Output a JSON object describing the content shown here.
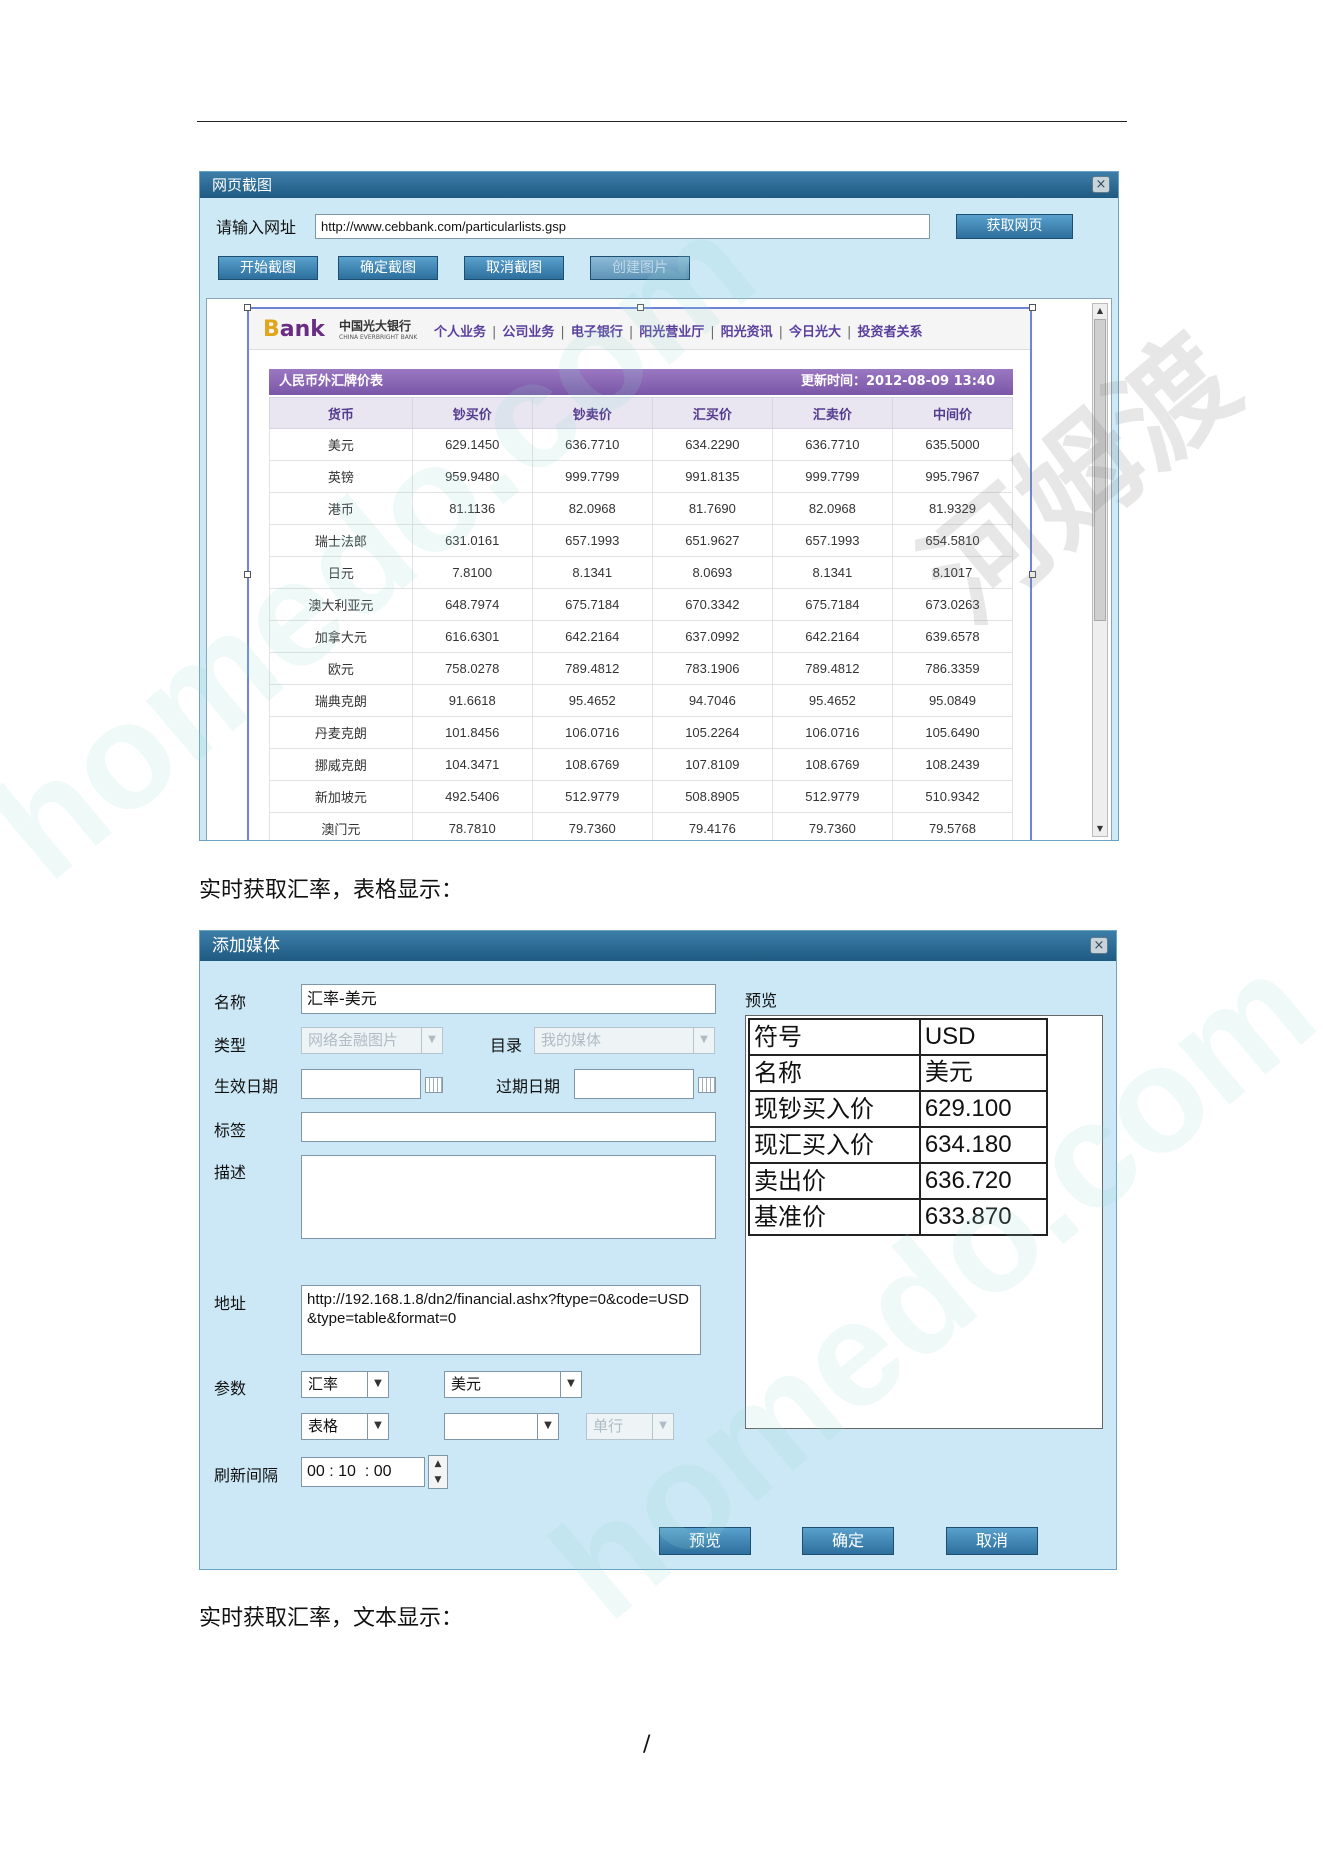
{
  "screenshot1": {
    "title": "网页截图",
    "close": "×",
    "url_label": "请输入网址",
    "url_value": "http://www.cebbank.com/particularlists.gsp",
    "fetch_button": "获取网页",
    "buttons": [
      "开始截图",
      "确定截图",
      "取消截图",
      "创建图片"
    ],
    "bank": {
      "logo_first": "B",
      "logo_rest": "ank",
      "name": "中国光大银行",
      "name_en": "CHINA EVERBRIGHT BANK",
      "nav": [
        "个人业务",
        "公司业务",
        "电子银行",
        "阳光营业厅",
        "阳光资讯",
        "今日光大",
        "投资者关系"
      ],
      "separator": "|"
    },
    "table_title": "人民币外汇牌价表",
    "updated": "更新时间：2012-08-09 13:40",
    "columns": [
      "货币",
      "钞买价",
      "钞卖价",
      "汇买价",
      "汇卖价",
      "中间价"
    ],
    "rows": [
      [
        "美元",
        "629.1450",
        "636.7710",
        "634.2290",
        "636.7710",
        "635.5000"
      ],
      [
        "英镑",
        "959.9480",
        "999.7799",
        "991.8135",
        "999.7799",
        "995.7967"
      ],
      [
        "港币",
        "81.1136",
        "82.0968",
        "81.7690",
        "82.0968",
        "81.9329"
      ],
      [
        "瑞士法郎",
        "631.0161",
        "657.1993",
        "651.9627",
        "657.1993",
        "654.5810"
      ],
      [
        "日元",
        "7.8100",
        "8.1341",
        "8.0693",
        "8.1341",
        "8.1017"
      ],
      [
        "澳大利亚元",
        "648.7974",
        "675.7184",
        "670.3342",
        "675.7184",
        "673.0263"
      ],
      [
        "加拿大元",
        "616.6301",
        "642.2164",
        "637.0992",
        "642.2164",
        "639.6578"
      ],
      [
        "欧元",
        "758.0278",
        "789.4812",
        "783.1906",
        "789.4812",
        "786.3359"
      ],
      [
        "瑞典克朗",
        "91.6618",
        "95.4652",
        "94.7046",
        "95.4652",
        "95.0849"
      ],
      [
        "丹麦克朗",
        "101.8456",
        "106.0716",
        "105.2264",
        "106.0716",
        "105.6490"
      ],
      [
        "挪威克朗",
        "104.3471",
        "108.6769",
        "107.8109",
        "108.6769",
        "108.2439"
      ],
      [
        "新加坡元",
        "492.5406",
        "512.9779",
        "508.8905",
        "512.9779",
        "510.9342"
      ],
      [
        "澳门元",
        "78.7810",
        "79.7360",
        "79.4176",
        "79.7360",
        "79.5768"
      ]
    ]
  },
  "caption1": "实时获取汇率，表格显示：",
  "screenshot2": {
    "title": "添加媒体",
    "close": "×",
    "labels": {
      "name": "名称",
      "type": "类型",
      "catalog": "目录",
      "effective_date": "生效日期",
      "expire_date": "过期日期",
      "tag": "标签",
      "description": "描述",
      "address": "地址",
      "params": "参数",
      "refresh": "刷新间隔",
      "preview": "预览"
    },
    "name_value": "汇率-美元",
    "type_value": "网络金融图片",
    "catalog_value": "我的媒体",
    "address_value": "http://192.168.1.8/dn2/financial.ashx?ftype=0&code=USD&type=table&format=0",
    "param1": "汇率",
    "param2": "美元",
    "param3": "表格",
    "param4": "",
    "param5": "单行",
    "refresh_value": "00 : 10  : 00",
    "preview_table": [
      [
        "符号",
        "USD"
      ],
      [
        "名称",
        "美元"
      ],
      [
        "现钞买入价",
        "629.100"
      ],
      [
        "现汇买入价",
        "634.180"
      ],
      [
        "卖出价",
        "636.720"
      ],
      [
        "基准价",
        "633.870"
      ]
    ],
    "buttons": {
      "preview": "预览",
      "ok": "确定",
      "cancel": "取消"
    }
  },
  "caption2": "实时获取汇率，文本显示：",
  "page_number": "/",
  "watermark": [
    "homedo.com",
    "河姆渡"
  ],
  "colors": {
    "title_bar": "#1f5a82",
    "dialog_bg": "#cce8f6",
    "table_header": "#7a56a8"
  }
}
